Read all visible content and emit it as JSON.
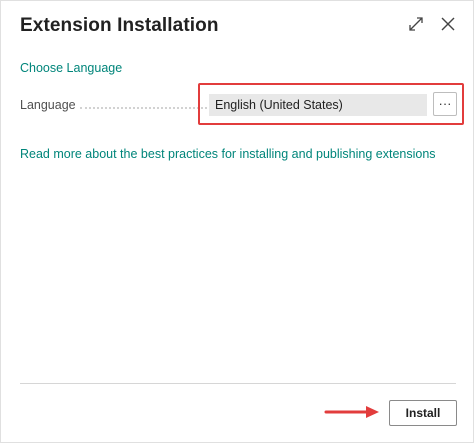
{
  "dialog": {
    "title": "Extension Installation",
    "expand_icon": "expand-icon",
    "close_icon": "close-icon"
  },
  "section": {
    "link_label": "Choose Language"
  },
  "language_field": {
    "label": "Language",
    "value": "English (United States)",
    "lookup_label": "···"
  },
  "info_link": {
    "label": "Read more about the best practices for installing and publishing extensions"
  },
  "footer": {
    "install_label": "Install"
  },
  "colors": {
    "accent_link": "#00857a",
    "highlight": "#e23c3c"
  }
}
